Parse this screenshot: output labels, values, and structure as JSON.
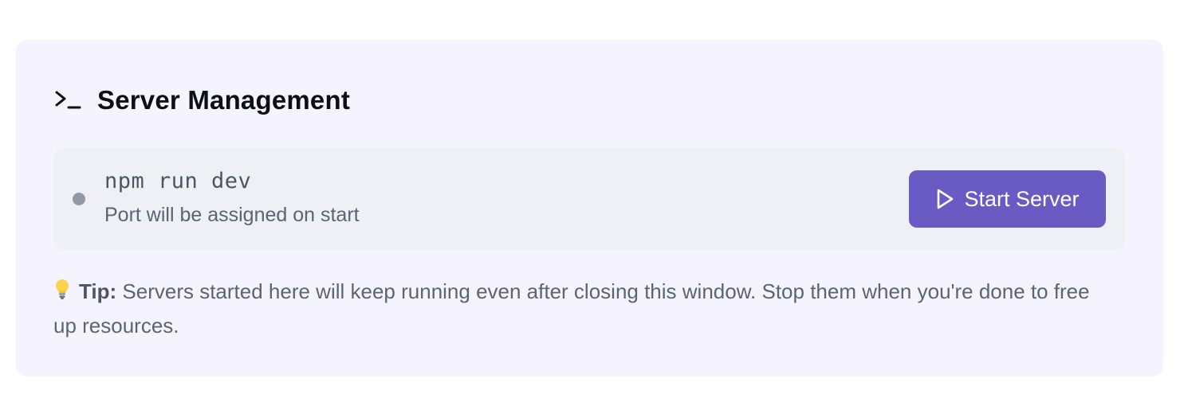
{
  "panel": {
    "title": "Server Management",
    "title_icon": "terminal-icon"
  },
  "server": {
    "command": "npm run dev",
    "port_info": "Port will be assigned on start",
    "status": "stopped",
    "status_color": "#9299a6",
    "start_button": {
      "label": "Start Server",
      "icon": "play-icon",
      "color": "#6a5ac4"
    }
  },
  "tip": {
    "icon": "lightbulb-icon",
    "label": "Tip:",
    "text": " Servers started here will keep running even after closing this window. Stop them when you're done to free up resources."
  }
}
